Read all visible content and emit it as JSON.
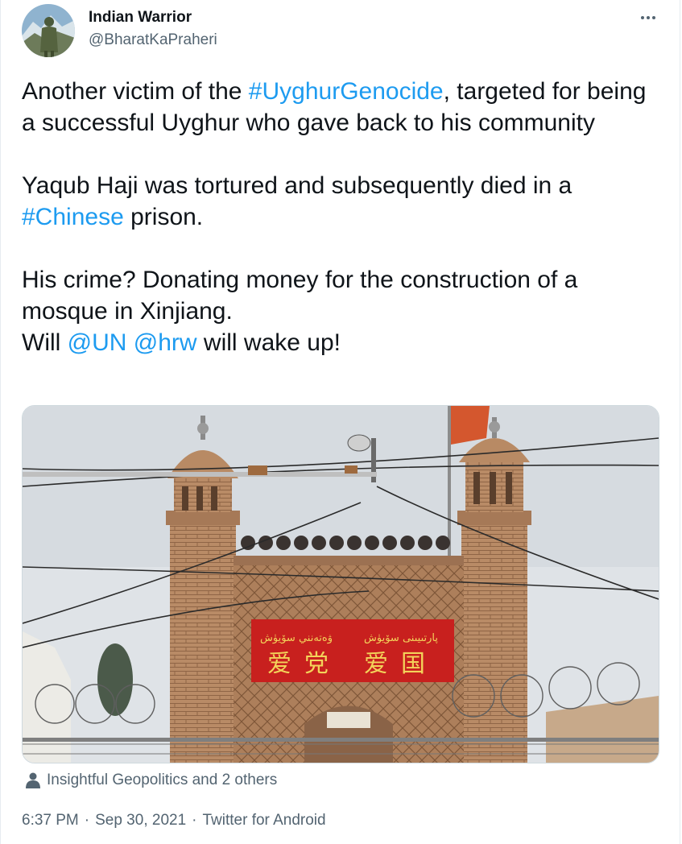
{
  "author": {
    "name": "Indian Warrior",
    "handle": "@BharatKaPraheri"
  },
  "tweet": {
    "p1": {
      "before": "Another victim of the ",
      "hashtag": "#UyghurGenocide",
      "after": ", targeted for being a successful Uyghur who gave back to his community"
    },
    "p2": {
      "before": "Yaqub Haji was tortured and subsequently died in a ",
      "hashtag": "#Chinese",
      "after": " prison."
    },
    "p3": {
      "line1": "His crime? Donating money for the construction of a mosque in Xinjiang.",
      "will": "Will ",
      "mention1": "@UN",
      "space": " ",
      "mention2": "@hrw",
      "after": " will wake up!"
    }
  },
  "media": {
    "banner_uyghur_left": "ۋەتەنني سۆيۈش",
    "banner_uyghur_right": "پارتىيىنى سۆيۈش",
    "banner_chinese_left": "爱党",
    "banner_chinese_right": "爱国"
  },
  "tagged": {
    "icon": "person-icon",
    "text": "Insightful Geopolitics and 2 others"
  },
  "meta": {
    "time": "6:37 PM",
    "sep1": "·",
    "date": "Sep 30, 2021",
    "sep2": "·",
    "source": "Twitter for Android"
  },
  "colors": {
    "link": "#1d9bf0",
    "secondary_text": "#536471",
    "banner_red": "#c8201e",
    "banner_text": "#f3d35a"
  }
}
